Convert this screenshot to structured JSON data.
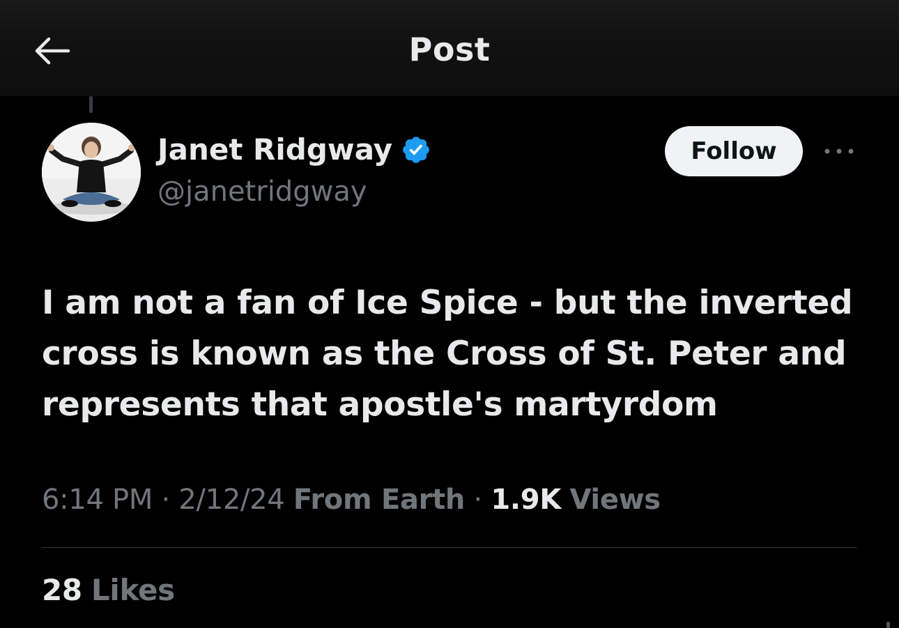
{
  "header": {
    "title": "Post",
    "back_icon": "arrow-left-icon"
  },
  "author": {
    "name": "Janet Ridgway",
    "handle": "@janetridgway",
    "verified_icon": "verified-badge-icon",
    "verified_color": "#1d9bf0"
  },
  "actions": {
    "follow_label": "Follow",
    "more_icon": "more-horizontal-icon"
  },
  "post": {
    "text": "I am not a fan of Ice Spice - but the inverted cross is known as the Cross of St. Peter and represents that apostle's martyrdom",
    "time": "6:14 PM",
    "separator": "·",
    "date": "2/12/24",
    "source": "From Earth",
    "views_count": "1.9K",
    "views_label": "Views"
  },
  "stats": {
    "likes_count": "28",
    "likes_label": "Likes"
  },
  "colors": {
    "background": "#000000",
    "text_primary": "#e7e9ea",
    "text_secondary": "#71767b",
    "accent": "#1d9bf0",
    "divider": "#2f3336"
  }
}
